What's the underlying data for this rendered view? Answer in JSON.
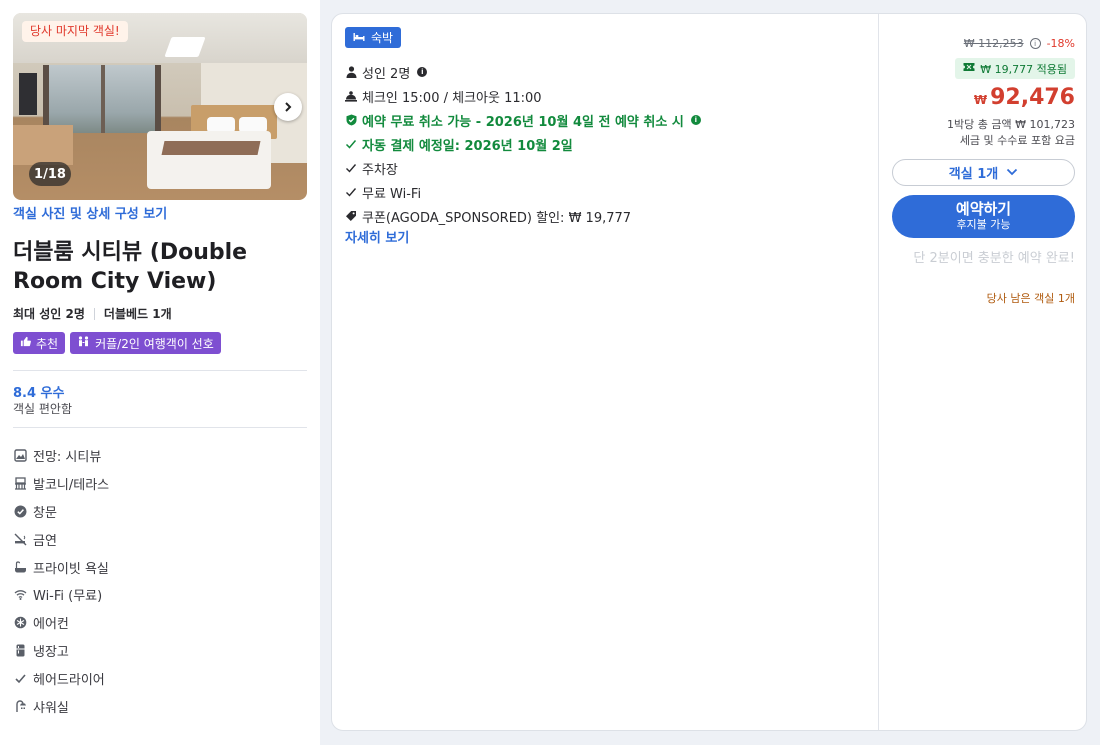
{
  "room": {
    "photo_badge": "당사 마지막 객실!",
    "photo_counter": "1/18",
    "photo_link": "객실 사진 및 상세 구성 보기",
    "title": "더블룸 시티뷰 (Double Room City View)",
    "max_guests": "최대 성인 2명",
    "bed": "더블베드 1개",
    "tags": [
      {
        "label": "추천",
        "icon": "thumbs-up-icon"
      },
      {
        "label": "커플/2인 여행객이 선호",
        "icon": "couple-icon"
      }
    ],
    "score": "8.4 우수",
    "score_sub": "객실 편안함",
    "amenities": [
      {
        "label": "전망: 시티뷰",
        "icon": "view-icon"
      },
      {
        "label": "발코니/테라스",
        "icon": "balcony-icon"
      },
      {
        "label": "창문",
        "icon": "window-icon"
      },
      {
        "label": "금연",
        "icon": "no-smoking-icon"
      },
      {
        "label": "프라이빗 욕실",
        "icon": "bathtub-icon"
      },
      {
        "label": "Wi-Fi (무료)",
        "icon": "wifi-icon"
      },
      {
        "label": "에어컨",
        "icon": "air-conditioner-icon"
      },
      {
        "label": "냉장고",
        "icon": "refrigerator-icon"
      },
      {
        "label": "헤어드라이어",
        "icon": "check-icon"
      },
      {
        "label": "샤워실",
        "icon": "shower-icon"
      }
    ]
  },
  "offer": {
    "type_badge": "숙박",
    "policies": {
      "guests": "성인 2명",
      "checkin": "체크인 15:00 / 체크아웃 11:00",
      "free_cancel": "예약 무료 취소 가능 - 2026년 10월 4일 전 예약 취소 시",
      "auto_payment": "자동 결제 예정일: 2026년 10월 2일",
      "parking": "주차장",
      "wifi": "무료 Wi-Fi",
      "coupon": "쿠폰(AGODA_SPONSORED) 할인: ₩ 19,777"
    },
    "more_link": "자세히 보기"
  },
  "price": {
    "original": "₩ 112,253",
    "discount": "-18%",
    "coupon_applied": "₩ 19,777 적용됨",
    "currency": "₩",
    "final": "92,476",
    "total_note": "1박당 총 금액 ₩ 101,723",
    "tax_note": "세금 및 수수료 포함 요금",
    "room_select": "객실 1개",
    "book_label": "예약하기",
    "book_sub": "후지불 가능",
    "urgency": "단 2분이면 충분한 예약 완료!",
    "rooms_left": "당사 남은 객실 1개"
  },
  "colors": {
    "accent": "#2f6cd8",
    "price_red": "#d23f2f",
    "green": "#128a3d",
    "tag_purple": "#7e4fd1"
  }
}
